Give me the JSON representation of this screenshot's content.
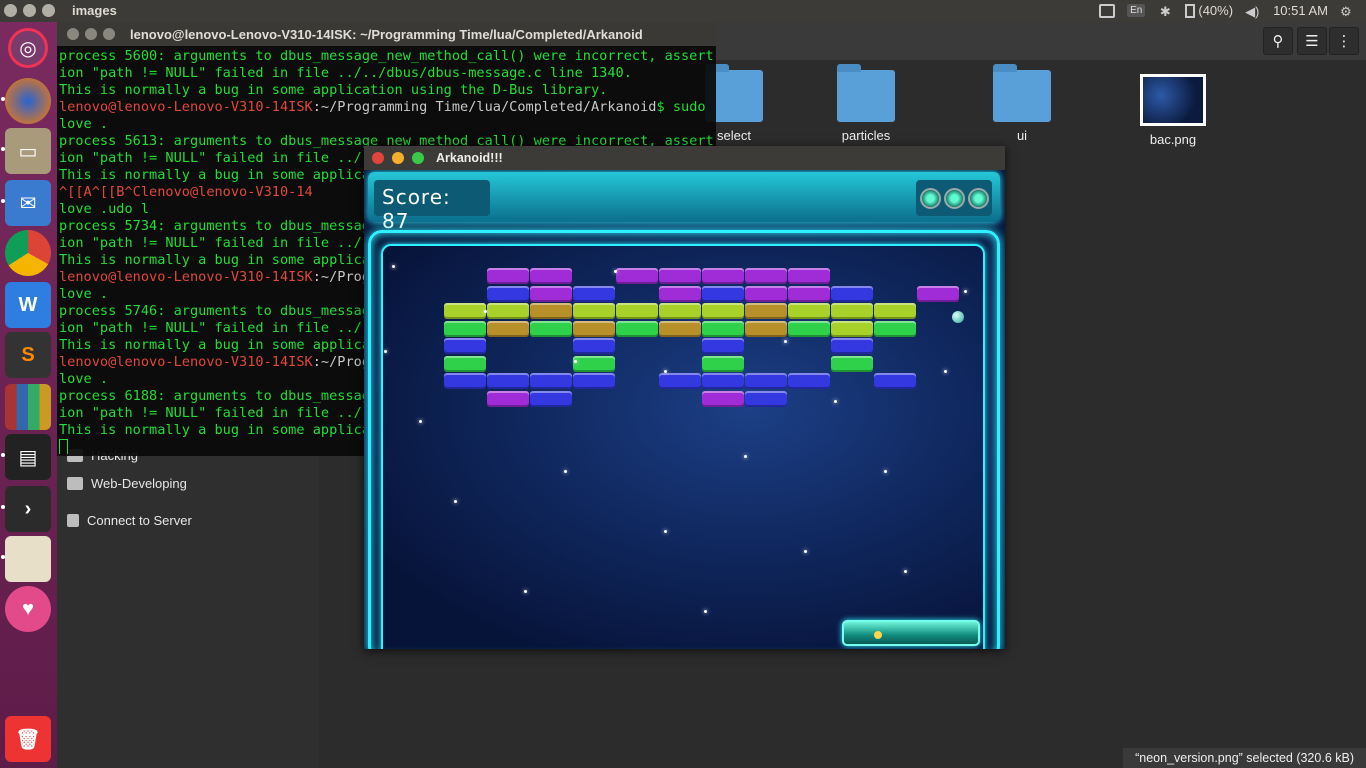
{
  "top_panel": {
    "app_name": "images",
    "keyboard": "En",
    "battery": "(40%)",
    "clock": "10:51 AM"
  },
  "launcher": {
    "items": [
      "ubuntu-dash",
      "firefox",
      "files",
      "mail",
      "chrome",
      "wps-writer",
      "sublime",
      "books",
      "terminal",
      "terminal-prompt",
      "notes",
      "health",
      "trash"
    ]
  },
  "files": {
    "sidebar": {
      "items": [
        "Hacking",
        "Web-Developing",
        "Connect to Server"
      ]
    },
    "items": [
      {
        "label": "select",
        "kind": "folder"
      },
      {
        "label": "particles",
        "kind": "folder"
      },
      {
        "label": "ui",
        "kind": "folder"
      },
      {
        "label": "bac.png",
        "kind": "image"
      }
    ],
    "status": "“neon_version.png” selected  (320.6 kB)"
  },
  "terminal": {
    "title": "lenovo@lenovo-Lenovo-V310-14ISK: ~/Programming Time/lua/Completed/Arkanoid",
    "lines": [
      {
        "kind": "text",
        "text": "process 5600: arguments to dbus_message_new_method_call() were incorrect, assert"
      },
      {
        "kind": "text",
        "text": "ion \"path != NULL\" failed in file ../../dbus/dbus-message.c line 1340."
      },
      {
        "kind": "text",
        "text": "This is normally a bug in some application using the D-Bus library."
      },
      {
        "kind": "prompt",
        "user": "lenovo@lenovo-Lenovo-V310-14ISK",
        "path": ":~/Programming Time/lua/Completed/Arkanoid",
        "cmd": "$ sudo"
      },
      {
        "kind": "text",
        "text": "love ."
      },
      {
        "kind": "text",
        "text": "process 5613: arguments to dbus_message_new_method_call() were incorrect, assert"
      },
      {
        "kind": "text",
        "text": "ion \"path != NULL\" failed in file ../.."
      },
      {
        "kind": "text",
        "text": "This is normally a bug in some applica"
      },
      {
        "kind": "prompt",
        "user": "^[[A^[[B^Clenovo@lenovo-V310-14",
        "path": "",
        "cmd": ""
      },
      {
        "kind": "text",
        "text": "love .udo l"
      },
      {
        "kind": "text",
        "text": "process 5734: arguments to dbus_messag"
      },
      {
        "kind": "text",
        "text": "ion \"path != NULL\" failed in file ../.."
      },
      {
        "kind": "text",
        "text": "This is normally a bug in some applica"
      },
      {
        "kind": "prompt",
        "user": "lenovo@lenovo-Lenovo-V310-14ISK",
        "path": ":~/Prog",
        "cmd": ""
      },
      {
        "kind": "text",
        "text": "love ."
      },
      {
        "kind": "text",
        "text": "process 5746: arguments to dbus_messag"
      },
      {
        "kind": "text",
        "text": "ion \"path != NULL\" failed in file ../.."
      },
      {
        "kind": "text",
        "text": "This is normally a bug in some applica"
      },
      {
        "kind": "prompt",
        "user": "lenovo@lenovo-Lenovo-V310-14ISK",
        "path": ":~/Prog",
        "cmd": ""
      },
      {
        "kind": "text",
        "text": "love ."
      },
      {
        "kind": "text",
        "text": "process 6188: arguments to dbus_messag"
      },
      {
        "kind": "text",
        "text": "ion \"path != NULL\" failed in file ../.."
      },
      {
        "kind": "text",
        "text": "This is normally a bug in some applica"
      }
    ]
  },
  "game": {
    "window_title": "Arkanoid!!!",
    "score_text": "Score: 87",
    "lives": 3,
    "brick_rows": [
      "..PP.PPPPP....",
      "..BPB.PBPPB.P.",
      ".YYOYYYYOYYY..",
      ".GOGOGOGOGYG..",
      ".B..B..B..B...",
      ".G..G..G..G...",
      ".BBBB.BBBB.B..",
      "..PB...PB....."
    ],
    "brick_colors": {
      "P": "#a02cd8",
      "B": "#3338e0",
      "Y": "#a8d12a",
      "O": "#b8902a",
      "G": "#2fd14a"
    }
  }
}
